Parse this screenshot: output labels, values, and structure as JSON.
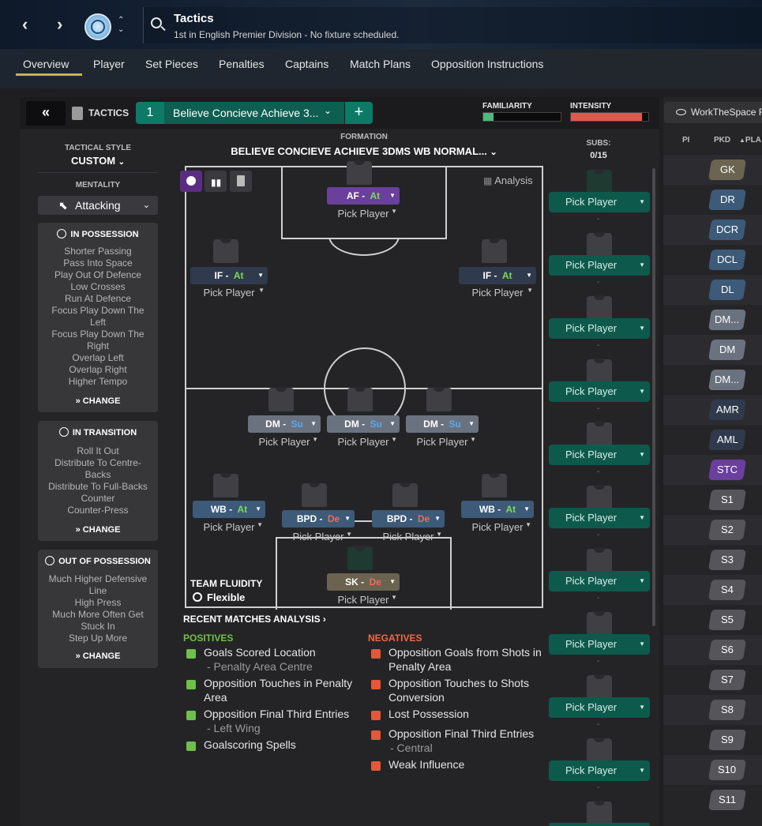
{
  "header": {
    "title": "Tactics",
    "subtitle": "1st in English Premier Division - No fixture scheduled."
  },
  "tabs": [
    "Overview",
    "Player",
    "Set Pieces",
    "Penalties",
    "Captains",
    "Match Plans",
    "Opposition Instructions"
  ],
  "tactics_bar": {
    "label": "TACTICS",
    "slot": "1",
    "name": "Believe Concieve Achieve 3...",
    "familiarity_label": "FAMILIARITY",
    "intensity_label": "INTENSITY",
    "familiarity_level": 0.13,
    "intensity_level": 0.92
  },
  "left": {
    "style_label": "TACTICAL STYLE",
    "style_value": "CUSTOM",
    "mentality_label": "MENTALITY",
    "mentality_value": "Attacking",
    "in_possession": {
      "title": "IN POSSESSION",
      "items": [
        "Shorter Passing",
        "Pass Into Space",
        "Play Out Of Defence",
        "Low Crosses",
        "Run At Defence",
        "Focus Play Down The Left",
        "Focus Play Down The Right",
        "Overlap Left",
        "Overlap Right",
        "Higher Tempo"
      ]
    },
    "in_transition": {
      "title": "IN TRANSITION",
      "items": [
        "Roll It Out",
        "Distribute To Centre-Backs",
        "Distribute To Full-Backs",
        "Counter",
        "Counter-Press"
      ]
    },
    "out_of_possession": {
      "title": "OUT OF POSSESSION",
      "items": [
        "Much Higher Defensive Line",
        "High Press",
        "Much More Often Get Stuck In",
        "Step Up More"
      ]
    },
    "change_label": "CHANGE"
  },
  "formation": {
    "label": "FORMATION",
    "name": "BELIEVE CONCIEVE ACHIEVE 3DMS WB NORMAL...",
    "analysis_label": "Analysis",
    "pick_label": "Pick Player",
    "positions": [
      {
        "role": "AF",
        "duty": "At"
      },
      {
        "role": "IF",
        "duty": "At"
      },
      {
        "role": "IF",
        "duty": "At"
      },
      {
        "role": "DM",
        "duty": "Su"
      },
      {
        "role": "DM",
        "duty": "Su"
      },
      {
        "role": "DM",
        "duty": "Su"
      },
      {
        "role": "WB",
        "duty": "At"
      },
      {
        "role": "BPD",
        "duty": "De"
      },
      {
        "role": "BPD",
        "duty": "De"
      },
      {
        "role": "WB",
        "duty": "At"
      },
      {
        "role": "SK",
        "duty": "De"
      }
    ],
    "fluidity_label": "TEAM FLUIDITY",
    "fluidity_value": "Flexible"
  },
  "analysis": {
    "title": "RECENT MATCHES ANALYSIS",
    "positives_label": "POSITIVES",
    "negatives_label": "NEGATIVES",
    "positives": [
      {
        "text": "Goals Scored Location",
        "sub": "- Penalty Area Centre"
      },
      {
        "text": "Opposition Touches in Penalty Area",
        "sub": ""
      },
      {
        "text": "Opposition Final Third Entries",
        "sub": "- Left Wing"
      },
      {
        "text": "Goalscoring Spells",
        "sub": ""
      }
    ],
    "negatives": [
      {
        "text": "Opposition Goals from Shots in Penalty Area",
        "sub": ""
      },
      {
        "text": "Opposition Touches to Shots Conversion",
        "sub": ""
      },
      {
        "text": "Lost Possession",
        "sub": ""
      },
      {
        "text": "Opposition Final Third Entries",
        "sub": "- Central"
      },
      {
        "text": "Weak Influence",
        "sub": ""
      }
    ]
  },
  "subs": {
    "label": "SUBS:",
    "count": "0/15",
    "pick_label": "Pick Player",
    "dash": "-"
  },
  "right": {
    "view_label": "WorkTheSpace F",
    "col_pi": "PI",
    "col_pkd": "PKD",
    "col_pla": "PLA",
    "positions": [
      "GK",
      "DR",
      "DCR",
      "DCL",
      "DL",
      "DM...",
      "DM",
      "DM...",
      "AMR",
      "AML",
      "STC",
      "S1",
      "S2",
      "S3",
      "S4",
      "S5",
      "S6",
      "S7",
      "S8",
      "S9",
      "S10",
      "S11"
    ]
  },
  "colors": {
    "accent": "#0d7a66",
    "attack_duty": "#7ed957",
    "support_duty": "#5aa8f0",
    "defend_duty": "#f06a5a",
    "tab_underline": "#c8b24a"
  }
}
